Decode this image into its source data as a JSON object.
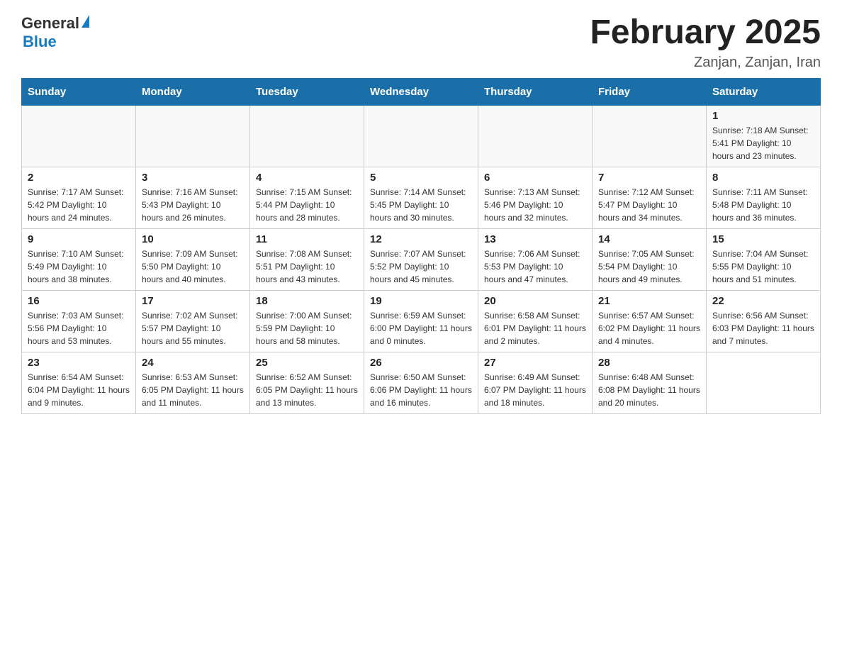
{
  "header": {
    "logo": {
      "general": "General",
      "blue": "Blue"
    },
    "title": "February 2025",
    "location": "Zanjan, Zanjan, Iran"
  },
  "calendar": {
    "days_of_week": [
      "Sunday",
      "Monday",
      "Tuesday",
      "Wednesday",
      "Thursday",
      "Friday",
      "Saturday"
    ],
    "weeks": [
      [
        {
          "day": "",
          "info": ""
        },
        {
          "day": "",
          "info": ""
        },
        {
          "day": "",
          "info": ""
        },
        {
          "day": "",
          "info": ""
        },
        {
          "day": "",
          "info": ""
        },
        {
          "day": "",
          "info": ""
        },
        {
          "day": "1",
          "info": "Sunrise: 7:18 AM\nSunset: 5:41 PM\nDaylight: 10 hours and 23 minutes."
        }
      ],
      [
        {
          "day": "2",
          "info": "Sunrise: 7:17 AM\nSunset: 5:42 PM\nDaylight: 10 hours and 24 minutes."
        },
        {
          "day": "3",
          "info": "Sunrise: 7:16 AM\nSunset: 5:43 PM\nDaylight: 10 hours and 26 minutes."
        },
        {
          "day": "4",
          "info": "Sunrise: 7:15 AM\nSunset: 5:44 PM\nDaylight: 10 hours and 28 minutes."
        },
        {
          "day": "5",
          "info": "Sunrise: 7:14 AM\nSunset: 5:45 PM\nDaylight: 10 hours and 30 minutes."
        },
        {
          "day": "6",
          "info": "Sunrise: 7:13 AM\nSunset: 5:46 PM\nDaylight: 10 hours and 32 minutes."
        },
        {
          "day": "7",
          "info": "Sunrise: 7:12 AM\nSunset: 5:47 PM\nDaylight: 10 hours and 34 minutes."
        },
        {
          "day": "8",
          "info": "Sunrise: 7:11 AM\nSunset: 5:48 PM\nDaylight: 10 hours and 36 minutes."
        }
      ],
      [
        {
          "day": "9",
          "info": "Sunrise: 7:10 AM\nSunset: 5:49 PM\nDaylight: 10 hours and 38 minutes."
        },
        {
          "day": "10",
          "info": "Sunrise: 7:09 AM\nSunset: 5:50 PM\nDaylight: 10 hours and 40 minutes."
        },
        {
          "day": "11",
          "info": "Sunrise: 7:08 AM\nSunset: 5:51 PM\nDaylight: 10 hours and 43 minutes."
        },
        {
          "day": "12",
          "info": "Sunrise: 7:07 AM\nSunset: 5:52 PM\nDaylight: 10 hours and 45 minutes."
        },
        {
          "day": "13",
          "info": "Sunrise: 7:06 AM\nSunset: 5:53 PM\nDaylight: 10 hours and 47 minutes."
        },
        {
          "day": "14",
          "info": "Sunrise: 7:05 AM\nSunset: 5:54 PM\nDaylight: 10 hours and 49 minutes."
        },
        {
          "day": "15",
          "info": "Sunrise: 7:04 AM\nSunset: 5:55 PM\nDaylight: 10 hours and 51 minutes."
        }
      ],
      [
        {
          "day": "16",
          "info": "Sunrise: 7:03 AM\nSunset: 5:56 PM\nDaylight: 10 hours and 53 minutes."
        },
        {
          "day": "17",
          "info": "Sunrise: 7:02 AM\nSunset: 5:57 PM\nDaylight: 10 hours and 55 minutes."
        },
        {
          "day": "18",
          "info": "Sunrise: 7:00 AM\nSunset: 5:59 PM\nDaylight: 10 hours and 58 minutes."
        },
        {
          "day": "19",
          "info": "Sunrise: 6:59 AM\nSunset: 6:00 PM\nDaylight: 11 hours and 0 minutes."
        },
        {
          "day": "20",
          "info": "Sunrise: 6:58 AM\nSunset: 6:01 PM\nDaylight: 11 hours and 2 minutes."
        },
        {
          "day": "21",
          "info": "Sunrise: 6:57 AM\nSunset: 6:02 PM\nDaylight: 11 hours and 4 minutes."
        },
        {
          "day": "22",
          "info": "Sunrise: 6:56 AM\nSunset: 6:03 PM\nDaylight: 11 hours and 7 minutes."
        }
      ],
      [
        {
          "day": "23",
          "info": "Sunrise: 6:54 AM\nSunset: 6:04 PM\nDaylight: 11 hours and 9 minutes."
        },
        {
          "day": "24",
          "info": "Sunrise: 6:53 AM\nSunset: 6:05 PM\nDaylight: 11 hours and 11 minutes."
        },
        {
          "day": "25",
          "info": "Sunrise: 6:52 AM\nSunset: 6:05 PM\nDaylight: 11 hours and 13 minutes."
        },
        {
          "day": "26",
          "info": "Sunrise: 6:50 AM\nSunset: 6:06 PM\nDaylight: 11 hours and 16 minutes."
        },
        {
          "day": "27",
          "info": "Sunrise: 6:49 AM\nSunset: 6:07 PM\nDaylight: 11 hours and 18 minutes."
        },
        {
          "day": "28",
          "info": "Sunrise: 6:48 AM\nSunset: 6:08 PM\nDaylight: 11 hours and 20 minutes."
        },
        {
          "day": "",
          "info": ""
        }
      ]
    ]
  }
}
